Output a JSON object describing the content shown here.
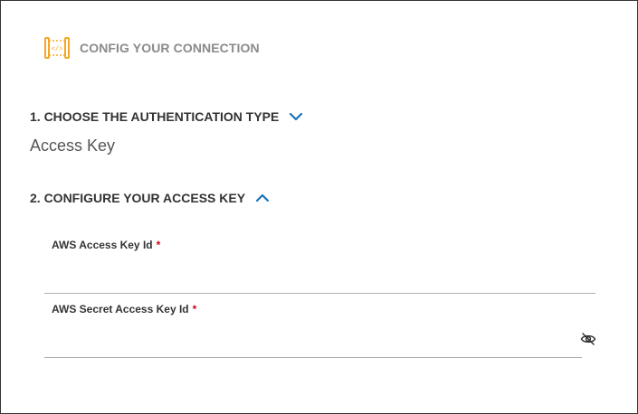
{
  "header": {
    "title": "CONFIG YOUR CONNECTION",
    "logo_icon": "api-bracket-icon"
  },
  "step1": {
    "label": "1. CHOOSE THE AUTHENTICATION TYPE",
    "state": "collapsed",
    "selected_value": "Access Key"
  },
  "step2": {
    "label": "2. CONFIGURE YOUR ACCESS KEY",
    "state": "expanded"
  },
  "fields": {
    "access_key_id": {
      "label": "AWS Access Key Id",
      "required_mark": "*",
      "value": ""
    },
    "secret_access_key": {
      "label": "AWS Secret Access Key Id",
      "required_mark": "*",
      "value": "",
      "toggle_icon": "eye-slash-icon"
    }
  },
  "colors": {
    "accent": "#1a73b8",
    "logo": "#f5a623",
    "required": "#d0021b"
  }
}
